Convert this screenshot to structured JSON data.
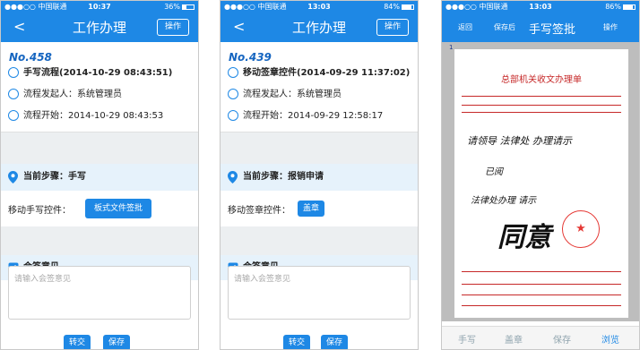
{
  "phone1": {
    "status": {
      "carrier": "●●●○○ 中国联通",
      "time": "10:37",
      "battery": "36%"
    },
    "nav": {
      "back": "<",
      "title": "工作办理",
      "action": "操作"
    },
    "doc_no": "No.458",
    "rows": [
      {
        "text": "手写流程(2014-10-29 08:43:51)",
        "bold": true
      },
      {
        "text": "流程发起人：系统管理员",
        "bold": false
      },
      {
        "text": "流程开始：2014-10-29 08:43:53",
        "bold": false
      }
    ],
    "step": "当前步骤：手写",
    "control_label": "移动手写控件：",
    "control_button": "板式文件签批",
    "sign_title": "会签意见",
    "sign_placeholder": "请输入会签意见",
    "btn_forward": "转交",
    "btn_save": "保存"
  },
  "phone2": {
    "status": {
      "carrier": "●●●○○ 中国联通",
      "time": "13:03",
      "battery": "84%"
    },
    "nav": {
      "back": "<",
      "title": "工作办理",
      "action": "操作"
    },
    "doc_no": "No.439",
    "rows": [
      {
        "text": "移动签章控件(2014-09-29 11:37:02)",
        "bold": true
      },
      {
        "text": "流程发起人：系统管理员",
        "bold": false
      },
      {
        "text": "流程开始：2014-09-29 12:58:17",
        "bold": false
      }
    ],
    "step": "当前步骤：报销申请",
    "control_label": "移动签章控件：",
    "control_button": "盖章",
    "sign_title": "会签意见",
    "sign_placeholder": "请输入会签意见",
    "btn_forward": "转交",
    "btn_save": "保存"
  },
  "phone3": {
    "status": {
      "carrier": "●●●○○ 中国联通",
      "time": "13:03",
      "battery": "86%"
    },
    "nav": {
      "back": "返回",
      "save_after": "保存后",
      "title": "手写签批",
      "action": "操作"
    },
    "page_number": "1",
    "doc_title": "总部机关收文办理单",
    "handwriting": [
      "请领导 法律处 办理请示",
      "已阅",
      "法律处办理 请示"
    ],
    "seal_star": "★",
    "tabs": [
      "手写",
      "盖章",
      "保存",
      "浏览"
    ],
    "active_tab": "浏览"
  }
}
